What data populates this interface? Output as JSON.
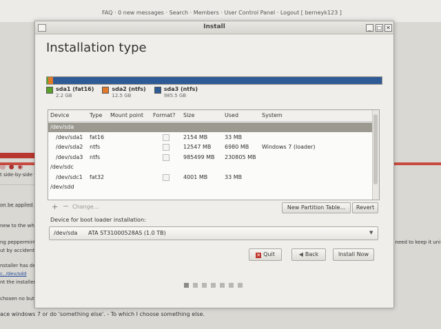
{
  "browser": {
    "top_links": "FAQ · 0 new messages · Search · Members · User Control Panel · Logout [ berneyk123 ]",
    "left_snippets": [
      "t side-by-side wit",
      "on be applied qua",
      "new to the wh",
      "ng peppermint f",
      "ut by accident!!",
      "nstaller has dete",
      "c, /dev/sdd",
      "nt the installer to",
      "chosen no but ar"
    ],
    "right_snippet": "and need to keep it uni",
    "bottom_line": "ace windows 7 or do 'something else'. - To which I choose something else."
  },
  "window": {
    "title": "Install",
    "heading": "Installation type",
    "controls": {
      "min": "_",
      "max": "□",
      "close": "✕"
    }
  },
  "partition_bar": {
    "segments": [
      {
        "name": "sda1 (fat16)",
        "size": "2.2 GB",
        "color": "#5aa02c",
        "fraction": 0.002
      },
      {
        "name": "sda2 (ntfs)",
        "size": "12.5 GB",
        "color": "#e07a2a",
        "fraction": 0.013
      },
      {
        "name": "sda3 (ntfs)",
        "size": "985.5 GB",
        "color": "#2e5a95",
        "fraction": 0.985
      }
    ]
  },
  "table": {
    "headers": [
      "Device",
      "Type",
      "Mount point",
      "Format?",
      "Size",
      "Used",
      "System"
    ],
    "rows": [
      {
        "device": "/dev/sda",
        "type": "",
        "mount": "",
        "size": "",
        "used": "",
        "system": "",
        "selected": true,
        "check": false
      },
      {
        "device": "/dev/sda1",
        "type": "fat16",
        "mount": "",
        "size": "2154 MB",
        "used": "33 MB",
        "system": "",
        "selected": false,
        "check": true
      },
      {
        "device": "/dev/sda2",
        "type": "ntfs",
        "mount": "",
        "size": "12547 MB",
        "used": "6980 MB",
        "system": "Windows 7 (loader)",
        "selected": false,
        "check": true
      },
      {
        "device": "/dev/sda3",
        "type": "ntfs",
        "mount": "",
        "size": "985499 MB",
        "used": "230805 MB",
        "system": "",
        "selected": false,
        "check": true
      },
      {
        "device": "/dev/sdc",
        "type": "",
        "mount": "",
        "size": "",
        "used": "",
        "system": "",
        "selected": false,
        "check": false
      },
      {
        "device": "/dev/sdc1",
        "type": "fat32",
        "mount": "",
        "size": "4001 MB",
        "used": "33 MB",
        "system": "",
        "selected": false,
        "check": true
      },
      {
        "device": "/dev/sdd",
        "type": "",
        "mount": "",
        "size": "",
        "used": "",
        "system": "",
        "selected": false,
        "check": false
      }
    ]
  },
  "toolbar": {
    "add": "+",
    "remove": "−",
    "change": "Change...",
    "new_table": "New Partition Table...",
    "revert": "Revert"
  },
  "bootloader": {
    "label": "Device for boot loader installation:",
    "device": "/dev/sda",
    "description": "ATA ST31000528AS (1.0 TB)"
  },
  "buttons": {
    "quit": "Quit",
    "back": "Back",
    "install": "Install Now"
  },
  "progress_dots": {
    "total": 7,
    "active_index": 0
  }
}
